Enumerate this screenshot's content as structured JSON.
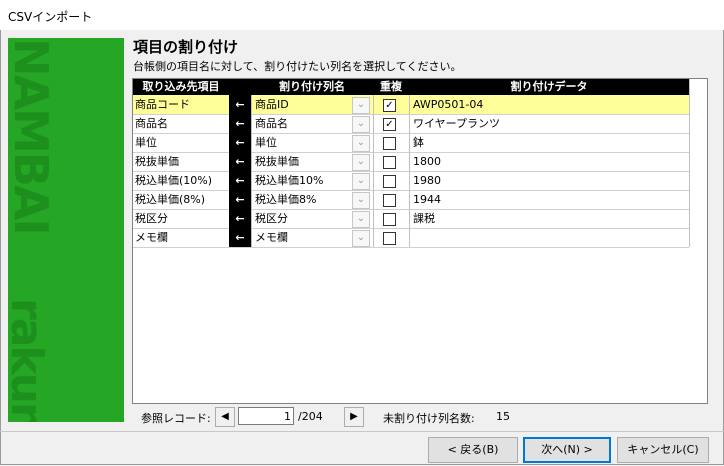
{
  "window": {
    "title": "CSVインポート"
  },
  "sidebar": {
    "brand_top": "NAMBAI",
    "brand_bottom": "rakuna"
  },
  "heading": "項目の割り付け",
  "subheading": "台帳側の項目名に対して、割り付けたい列名を選択してください。",
  "table": {
    "headers": {
      "source": "取り込み先項目",
      "mapped": "割り付け列名",
      "duplicate": "重複",
      "data": "割り付けデータ"
    },
    "arrow": "←",
    "dropdown_glyph": "⌄",
    "rows": [
      {
        "source": "商品コード",
        "mapped": "商品ID",
        "checked": true,
        "checkmark": "✓",
        "data": "AWP0501-04",
        "selected": true
      },
      {
        "source": "商品名",
        "mapped": "商品名",
        "checked": true,
        "checkmark": "✓",
        "data": "ワイヤープランツ",
        "selected": false
      },
      {
        "source": "単位",
        "mapped": "単位",
        "checked": false,
        "checkmark": "",
        "data": "鉢",
        "selected": false
      },
      {
        "source": "税抜単価",
        "mapped": "税抜単価",
        "checked": false,
        "checkmark": "",
        "data": "1800",
        "selected": false
      },
      {
        "source": "税込単価(10%)",
        "mapped": "税込単価10%",
        "checked": false,
        "checkmark": "",
        "data": "1980",
        "selected": false
      },
      {
        "source": "税込単価(8%)",
        "mapped": "税込単価8%",
        "checked": false,
        "checkmark": "",
        "data": "1944",
        "selected": false
      },
      {
        "source": "税区分",
        "mapped": "税区分",
        "checked": false,
        "checkmark": "",
        "data": "課税",
        "selected": false
      },
      {
        "source": "メモ欄",
        "mapped": "メモ欄",
        "checked": false,
        "checkmark": "",
        "data": "",
        "selected": false
      }
    ]
  },
  "footer": {
    "reference_label": "参照レコード:",
    "prev_glyph": "◀",
    "next_glyph": "▶",
    "record_value": "1",
    "record_total": "/204",
    "unassigned_label": "未割り付け列名数:",
    "unassigned_value": "15"
  },
  "buttons": {
    "back": "< 戻る(B)",
    "next": "次へ(N) >",
    "cancel": "キャンセル(C)"
  }
}
